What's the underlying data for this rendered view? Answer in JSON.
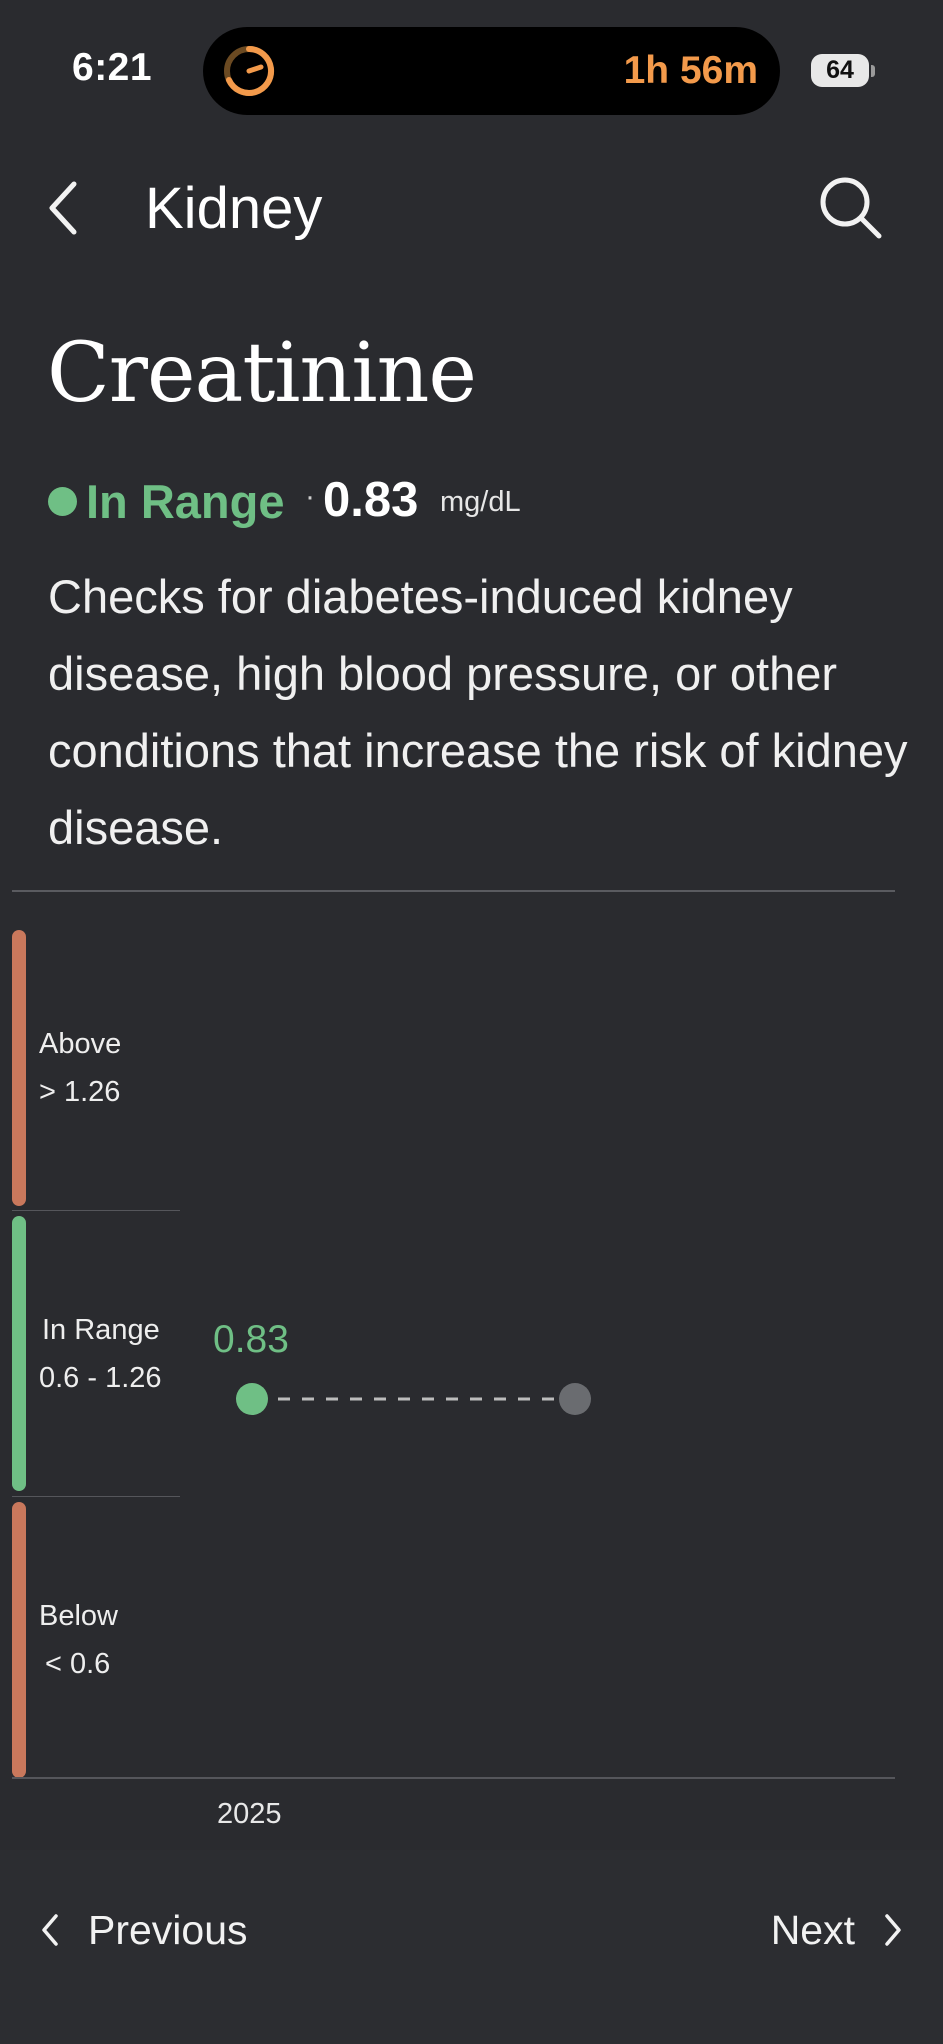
{
  "status_bar": {
    "time": "6:21",
    "timer_remaining": "1h 56m",
    "battery": "64"
  },
  "header": {
    "title": "Kidney"
  },
  "biomarker": {
    "name": "Creatinine",
    "status": "In Range",
    "separator": "·",
    "value": "0.83",
    "unit": "mg/dL",
    "description": "Checks for diabetes-induced kidney disease, high blood pressure, or other conditions that increase the risk of kidney disease."
  },
  "chart_data": {
    "type": "scatter",
    "bands": [
      {
        "label": "Above",
        "range": "> 1.26",
        "color": "#c9785c"
      },
      {
        "label": "In Range",
        "range": "0.6 - 1.26",
        "color": "#6fbf85"
      },
      {
        "label": "Below",
        "range": "< 0.6",
        "color": "#c9785c"
      }
    ],
    "points": [
      {
        "x": "2025",
        "y": 0.83,
        "label": "0.83",
        "status": "in-range",
        "color": "#6fbf85"
      }
    ],
    "x_tick_labels": [
      "2025"
    ]
  },
  "navigation": {
    "previous_label": "Previous",
    "next_label": "Next"
  }
}
